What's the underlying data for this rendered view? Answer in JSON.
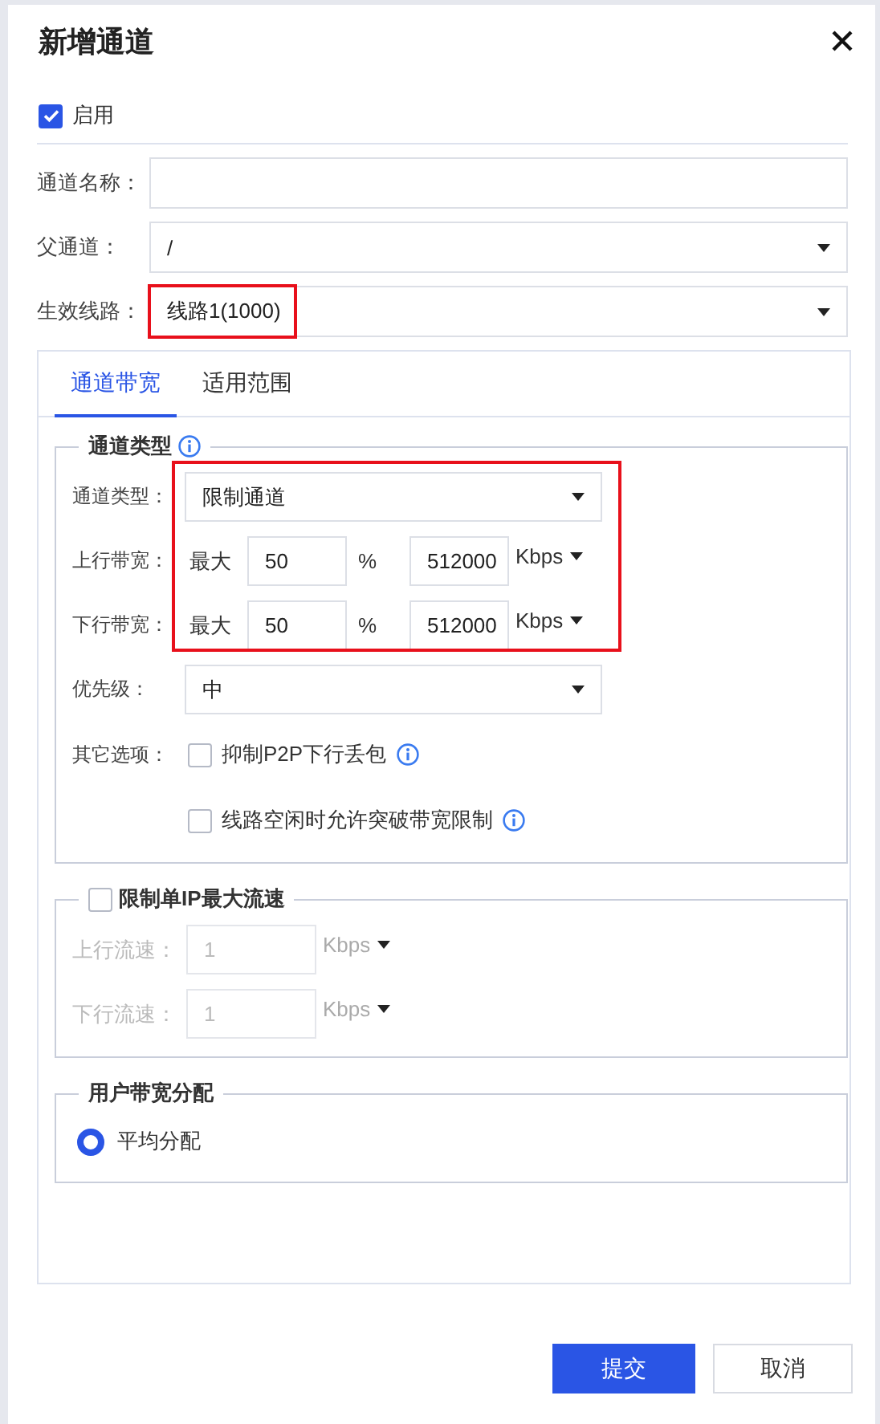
{
  "dialog": {
    "title": "新增通道"
  },
  "enable": {
    "label": "启用",
    "checked": true
  },
  "fields": [
    {
      "label": "通道名称：",
      "kind": "text"
    },
    {
      "label": "父通道：",
      "kind": "select",
      "value": "/"
    },
    {
      "label": "生效线路：",
      "kind": "select",
      "value": "线路1(1000)",
      "highlighted": true
    }
  ],
  "tabs": [
    {
      "label": "通道带宽",
      "selected": true
    },
    {
      "label": "适用范围",
      "selected": false
    }
  ],
  "channel_type": {
    "legend": "通道类型",
    "highlighted": true,
    "type": {
      "label": "通道类型：",
      "value": "限制通道"
    },
    "bandwidth": [
      {
        "label": "上行带宽：",
        "prefix": "最大",
        "percent": "50",
        "percent_unit": "%",
        "rate": "512000",
        "unit": "Kbps"
      },
      {
        "label": "下行带宽：",
        "prefix": "最大",
        "percent": "50",
        "percent_unit": "%",
        "rate": "512000",
        "unit": "Kbps"
      }
    ],
    "priority": {
      "label": "优先级：",
      "value": "中"
    },
    "options_label": "其它选项：",
    "options": [
      {
        "label": "抑制P2P下行丢包",
        "checked": false
      },
      {
        "label": "线路空闲时允许突破带宽限制",
        "checked": false
      }
    ]
  },
  "per_ip": {
    "legend": "限制单IP最大流速",
    "checked": false,
    "rows": [
      {
        "label": "上行流速：",
        "value": "1",
        "unit": "Kbps"
      },
      {
        "label": "下行流速：",
        "value": "1",
        "unit": "Kbps"
      }
    ]
  },
  "allocation": {
    "legend": "用户带宽分配",
    "options": [
      {
        "label": "平均分配",
        "selected": true
      }
    ]
  },
  "buttons": [
    {
      "label": "提交",
      "kind": "primary"
    },
    {
      "label": "取消",
      "kind": "secondary"
    }
  ]
}
